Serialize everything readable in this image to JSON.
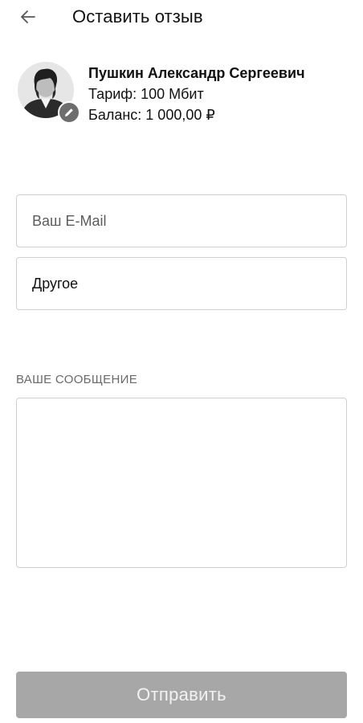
{
  "header": {
    "title": "Оставить отзыв",
    "back_icon": "arrow-left-icon"
  },
  "profile": {
    "name": "Пушкин Александр Сергеевич",
    "tariff_label": "Тариф:",
    "tariff_value": "100 Мбит",
    "balance_label": "Баланс:",
    "balance_value": "1 000,00 ₽",
    "avatar_icon": "user-portrait-icon",
    "edit_icon": "pencil-icon"
  },
  "form": {
    "email": {
      "placeholder": "Ваш E-Mail",
      "value": ""
    },
    "topic": {
      "value": "Другое"
    },
    "message": {
      "label": "ВАШЕ СООБЩЕНИЕ",
      "value": ""
    }
  },
  "submit": {
    "label": "Отправить"
  },
  "colors": {
    "button_disabled": "#a7a7a7",
    "border": "#cfcfcf",
    "edit_badge": "#6e6e6e"
  }
}
